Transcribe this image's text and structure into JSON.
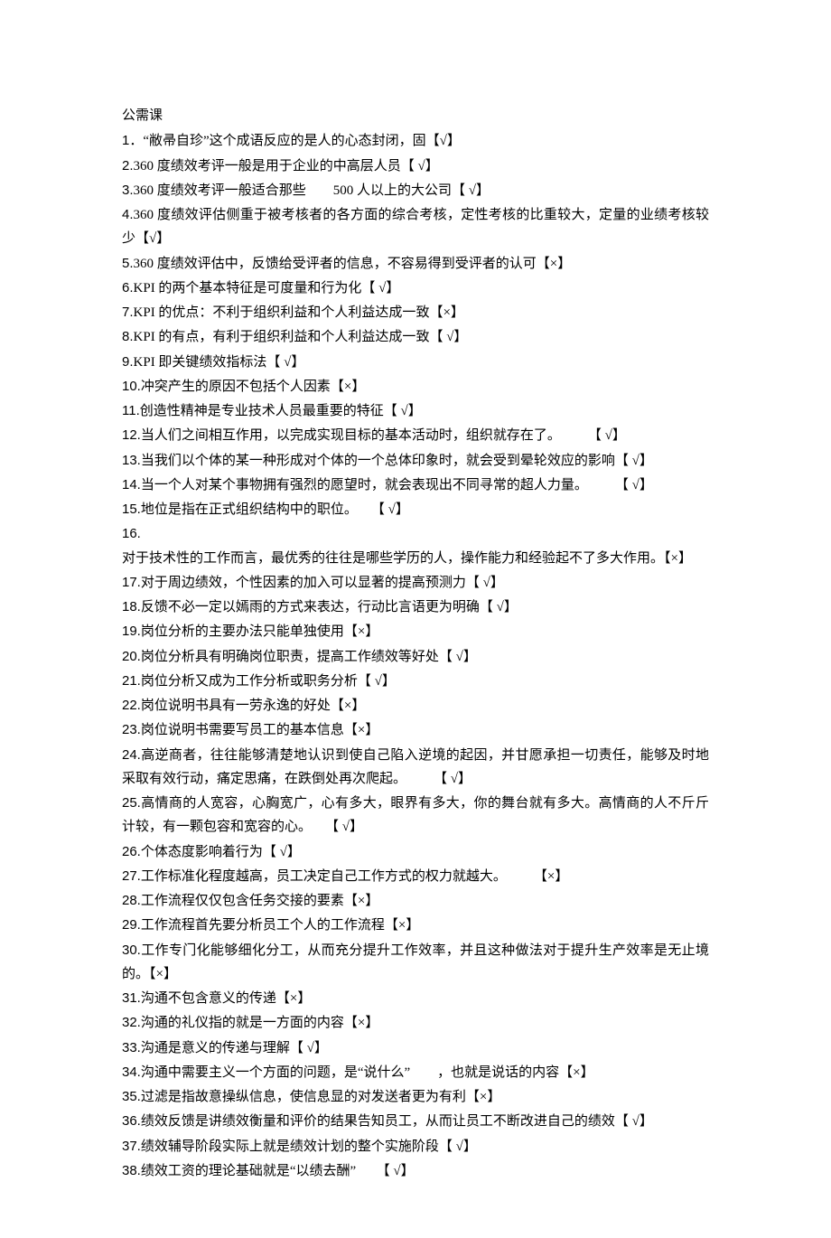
{
  "title": "公需课",
  "items": [
    {
      "num": "1．",
      "text": "“敝帚自珍”这个成语反应的是人的心态封闭，固【√】"
    },
    {
      "num": "2.",
      "text": "360 度绩效考评一般是用于企业的中高层人员【 √】"
    },
    {
      "num": "3.",
      "text": "360 度绩效考评一般适合那些　　500 人以上的大公司【 √】"
    },
    {
      "num": "4.",
      "text": "360 度绩效评估侧重于被考核者的各方面的综合考核，定性考核的比重较大，定量的业绩考核较少【√】"
    },
    {
      "num": "5.",
      "text": "360 度绩效评估中，反馈给受评者的信息，不容易得到受评者的认可【×】"
    },
    {
      "num": "6.",
      "text": "KPI 的两个基本特征是可度量和行为化【 √】"
    },
    {
      "num": "7.",
      "text": "KPI 的优点：不利于组织利益和个人利益达成一致【×】"
    },
    {
      "num": "8.",
      "text": "KPI 的有点，有利于组织利益和个人利益达成一致【 √】"
    },
    {
      "num": "9.",
      "text": "KPI 即关键绩效指标法【 √】"
    },
    {
      "num": "10.",
      "text": "冲突产生的原因不包括个人因素【×】"
    },
    {
      "num": "11.",
      "text": "创造性精神是专业技术人员最重要的特征【 √】"
    },
    {
      "num": "12.",
      "text": "当人们之间相互作用，以完成实现目标的基本活动时，组织就存在了。　　　【 √】"
    },
    {
      "num": "13.",
      "text": "当我们以个体的某一种形成对个体的一个总体印象时，就会受到晕轮效应的影响【 √】"
    },
    {
      "num": "14.",
      "text": "当一个人对某个事物拥有强烈的愿望时，就会表现出不同寻常的超人力量。　　　【 √】"
    },
    {
      "num": "15.",
      "text": "地位是指在正式组织结构中的职位。　　【 √】"
    },
    {
      "num": "16.",
      "text": "对于技术性的工作而言，最优秀的往往是哪些学历的人，操作能力和经验起不了多大作用。【×】"
    },
    {
      "num": "17.",
      "text": "对于周边绩效，个性因素的加入可以显著的提高预测力【 √】"
    },
    {
      "num": "18.",
      "text": "反馈不必一定以嫣雨的方式来表达，行动比言语更为明确【 √】"
    },
    {
      "num": "19.",
      "text": "岗位分析的主要办法只能单独使用【×】"
    },
    {
      "num": "20.",
      "text": "岗位分析具有明确岗位职责，提高工作绩效等好处【 √】"
    },
    {
      "num": "21.",
      "text": "岗位分析又成为工作分析或职务分析【 √】"
    },
    {
      "num": "22.",
      "text": "岗位说明书具有一劳永逸的好处【×】"
    },
    {
      "num": "23.",
      "text": "岗位说明书需要写员工的基本信息【×】"
    },
    {
      "num": "24.",
      "text": "高逆商者，往往能够清楚地认识到使自己陷入逆境的起因，并甘愿承担一切责任，能够及时地采取有效行动，痛定思痛，在跌倒处再次爬起。　　　【 √】"
    },
    {
      "num": "25.",
      "text": "高情商的人宽容，心胸宽广，心有多大，眼界有多大，你的舞台就有多大。高情商的人不斤斤计较，有一颗包容和宽容的心。　　【 √】"
    },
    {
      "num": "26.",
      "text": "个体态度影响着行为【 √】"
    },
    {
      "num": "27.",
      "text": "工作标准化程度越高，员工决定自己工作方式的权力就越大。　　　【×】"
    },
    {
      "num": "28.",
      "text": "工作流程仅仅包含任务交接的要素【×】"
    },
    {
      "num": "29.",
      "text": "工作流程首先要分析员工个人的工作流程【×】"
    },
    {
      "num": "30.",
      "text": "工作专门化能够细化分工，从而充分提升工作效率，并且这种做法对于提升生产效率是无止境的。【×】"
    },
    {
      "num": "31.",
      "text": "沟通不包含意义的传递【×】"
    },
    {
      "num": "32.",
      "text": "沟通的礼仪指的就是一方面的内容【×】"
    },
    {
      "num": "33.",
      "text": "沟通是意义的传递与理解【 √】"
    },
    {
      "num": "34.",
      "text": "沟通中需要主义一个方面的问题，是“说什么”　　，也就是说话的内容【×】"
    },
    {
      "num": "35.",
      "text": "过滤是指故意操纵信息，使信息显的对发送者更为有利【×】"
    },
    {
      "num": "36.",
      "text": "绩效反馈是讲绩效衡量和评价的结果告知员工，从而让员工不断改进自己的绩效【 √】"
    },
    {
      "num": "37.",
      "text": "绩效辅导阶段实际上就是绩效计划的整个实施阶段【 √】"
    },
    {
      "num": "38.",
      "text": "绩效工资的理论基础就是“以绩去酬”　　【 √】"
    }
  ]
}
